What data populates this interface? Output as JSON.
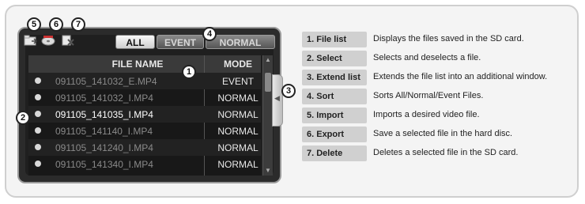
{
  "callouts": {
    "file_list": "1",
    "select": "2",
    "extend": "3",
    "sort": "4",
    "import": "5",
    "export": "6",
    "delete": "7"
  },
  "tabs": {
    "all": "ALL",
    "event": "EVENT",
    "normal": "NORMAL"
  },
  "list": {
    "col_name": "FILE NAME",
    "col_mode": "MODE",
    "rows": [
      {
        "name": "091105_141032_E.MP4",
        "mode": "EVENT"
      },
      {
        "name": "091105_141032_I.MP4",
        "mode": "NORMAL"
      },
      {
        "name": "091105_141035_I.MP4",
        "mode": "NORMAL"
      },
      {
        "name": "091105_141140_I.MP4",
        "mode": "NORMAL"
      },
      {
        "name": "091105_141240_I.MP4",
        "mode": "NORMAL"
      },
      {
        "name": "091105_141340_I.MP4",
        "mode": "NORMAL"
      }
    ]
  },
  "legend": [
    {
      "key": "1. File list",
      "value": "Displays the files saved in the SD card."
    },
    {
      "key": "2. Select",
      "value": "Selects and deselects a file."
    },
    {
      "key": "3. Extend list",
      "value": "Extends the file list into an additional window."
    },
    {
      "key": "4. Sort",
      "value": "Sorts All/Normal/Event Files."
    },
    {
      "key": "5. Import",
      "value": "Imports a desired video file."
    },
    {
      "key": "6. Export",
      "value": "Save a selected file in the hard disc."
    },
    {
      "key": "7. Delete",
      "value": "Deletes a selected file in the SD card."
    }
  ],
  "icons": {
    "import": "folder-import-icon",
    "export": "disc-export-icon",
    "delete": "file-delete-icon"
  }
}
